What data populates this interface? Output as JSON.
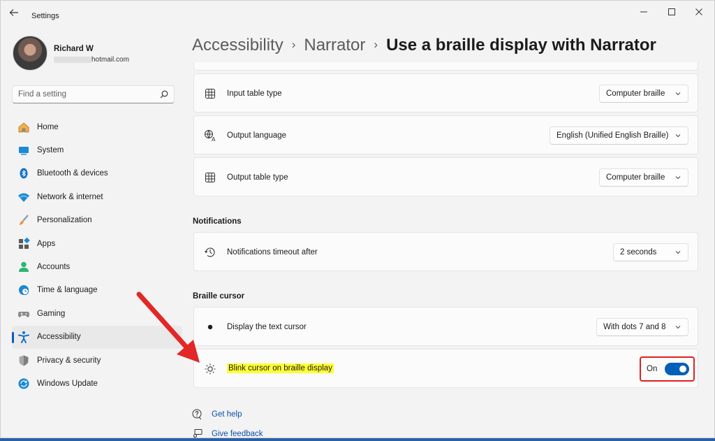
{
  "window": {
    "app_title": "Settings"
  },
  "profile": {
    "name": "Richard W",
    "email_visible": "hotmail.com"
  },
  "search": {
    "placeholder": "Find a setting"
  },
  "sidebar": {
    "items": [
      {
        "label": "Home",
        "icon": "home-icon"
      },
      {
        "label": "System",
        "icon": "system-icon"
      },
      {
        "label": "Bluetooth & devices",
        "icon": "bluetooth-icon"
      },
      {
        "label": "Network & internet",
        "icon": "wifi-icon"
      },
      {
        "label": "Personalization",
        "icon": "brush-icon"
      },
      {
        "label": "Apps",
        "icon": "apps-icon"
      },
      {
        "label": "Accounts",
        "icon": "accounts-icon"
      },
      {
        "label": "Time & language",
        "icon": "globe-icon"
      },
      {
        "label": "Gaming",
        "icon": "gamepad-icon"
      },
      {
        "label": "Accessibility",
        "icon": "accessibility-icon",
        "active": true
      },
      {
        "label": "Privacy & security",
        "icon": "shield-icon"
      },
      {
        "label": "Windows Update",
        "icon": "update-icon"
      }
    ]
  },
  "breadcrumb": {
    "items": [
      "Accessibility",
      "Narrator"
    ],
    "current": "Use a braille display with Narrator"
  },
  "settings": {
    "input_table_type": {
      "label": "Input table type",
      "value": "Computer braille"
    },
    "output_language": {
      "label": "Output language",
      "value": "English (Unified English Braille)"
    },
    "output_table_type": {
      "label": "Output table type",
      "value": "Computer braille"
    }
  },
  "notifications": {
    "section_title": "Notifications",
    "timeout": {
      "label": "Notifications timeout after",
      "value": "2 seconds"
    }
  },
  "braille_cursor": {
    "section_title": "Braille cursor",
    "display_text_cursor": {
      "label": "Display the text cursor",
      "value": "With dots 7 and 8"
    },
    "blink_cursor": {
      "label": "Blink cursor on braille display",
      "toggle_label": "On",
      "toggle_on": true
    }
  },
  "links": {
    "get_help": "Get help",
    "give_feedback": "Give feedback"
  },
  "colors": {
    "accent": "#005fb8",
    "highlight": "#ffff33",
    "annotation_red": "#e02020"
  }
}
